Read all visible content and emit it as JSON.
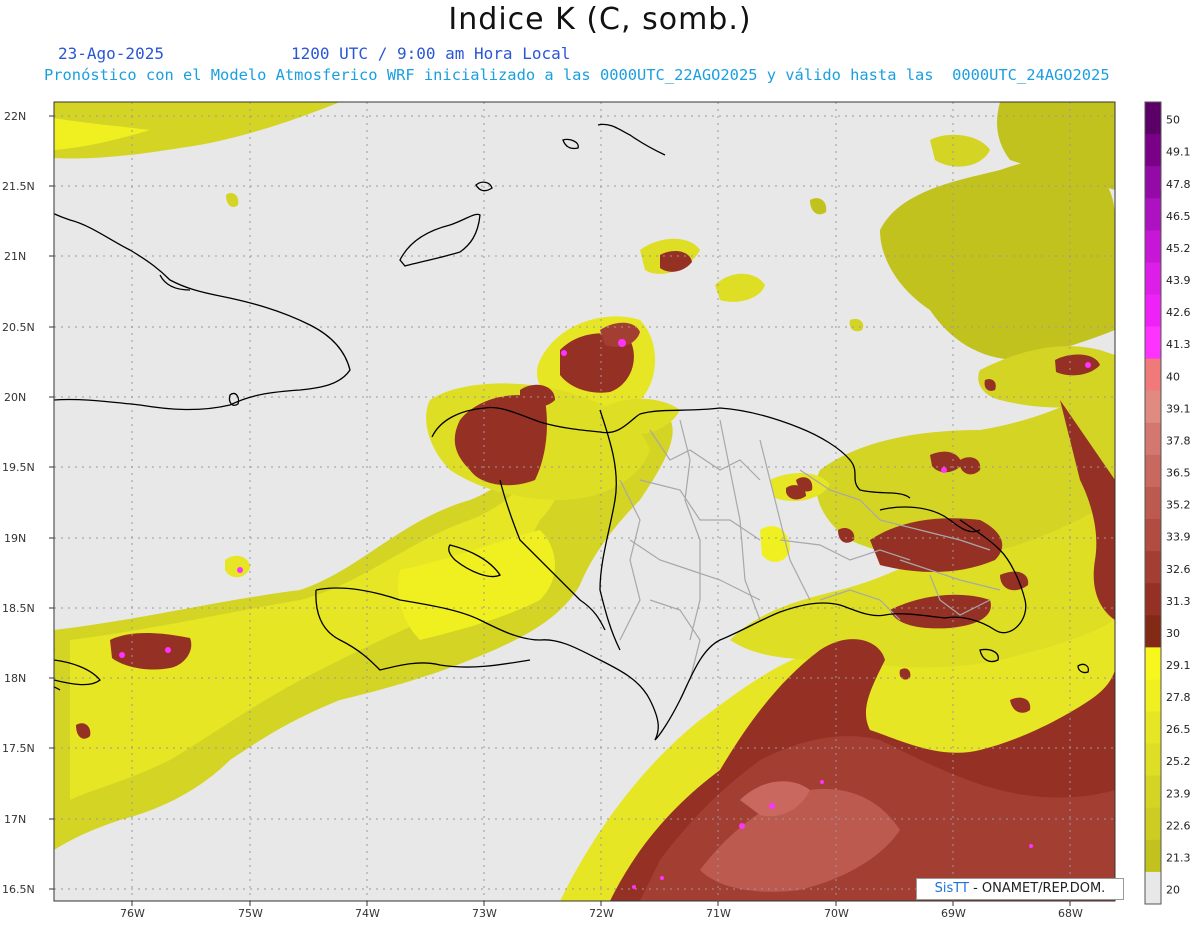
{
  "header": {
    "title": "Indice K (C, somb.)",
    "date": "23-Ago-2025",
    "time": "1200 UTC / 9:00 am Hora Local",
    "forecast_line": "Pronóstico con el Modelo Atmosferico WRF inicializado a las 0000UTC_22AGO2025 y válido hasta las  0000UTC_24AGO2025"
  },
  "map": {
    "lat_labels": [
      "22N",
      "21.5N",
      "21N",
      "20.5N",
      "20N",
      "19.5N",
      "19N",
      "18.5N",
      "18N",
      "17.5N",
      "17N",
      "16.5N"
    ],
    "lon_labels": [
      "76W",
      "75W",
      "74W",
      "73W",
      "72W",
      "71W",
      "70W",
      "69W",
      "68W"
    ]
  },
  "colorbar": {
    "labels": [
      "50",
      "49.1",
      "47.8",
      "46.5",
      "45.2",
      "43.9",
      "42.6",
      "41.3",
      "40",
      "39.1",
      "37.8",
      "36.5",
      "35.2",
      "33.9",
      "32.6",
      "31.3",
      "30",
      "29.1",
      "27.8",
      "26.5",
      "25.2",
      "23.9",
      "22.6",
      "21.3",
      "20"
    ],
    "colors": [
      "#5a0066",
      "#7a0088",
      "#930aa6",
      "#ad12c0",
      "#c616d6",
      "#dc1ee8",
      "#ee22f6",
      "#ff33ff",
      "#f07a7a",
      "#e08a82",
      "#d47770",
      "#c9685f",
      "#bd5a50",
      "#b04c40",
      "#a33e32",
      "#953024",
      "#822a16",
      "#f7f71e",
      "#f0f021",
      "#e6e624",
      "#dede24",
      "#d4d424",
      "#cccc22",
      "#c2c21e",
      "#e8e8e8"
    ]
  },
  "credit": {
    "brand": "SisTT",
    "text": " - ONAMET/REP.DOM."
  }
}
